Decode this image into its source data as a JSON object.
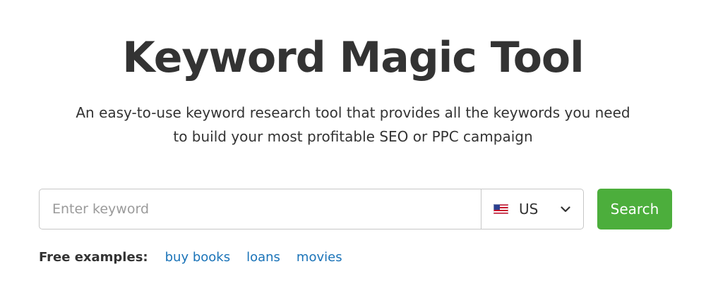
{
  "hero": {
    "title": "Keyword Magic Tool",
    "subtitle_line1": "An easy-to-use keyword research tool that provides all the keywords you need",
    "subtitle_line2": "to build your most profitable SEO or PPC campaign"
  },
  "search": {
    "input_value": "",
    "input_placeholder": "Enter keyword",
    "database": {
      "selected": "US",
      "icon": "us-flag-icon"
    },
    "button_label": "Search"
  },
  "examples": {
    "label": "Free examples:",
    "items": [
      "buy books",
      "loans",
      "movies"
    ]
  },
  "colors": {
    "text": "#333333",
    "button": "#4cae3c",
    "link": "#1a73b8",
    "border": "#c7c7c7",
    "placeholder": "#9a9a9a"
  }
}
